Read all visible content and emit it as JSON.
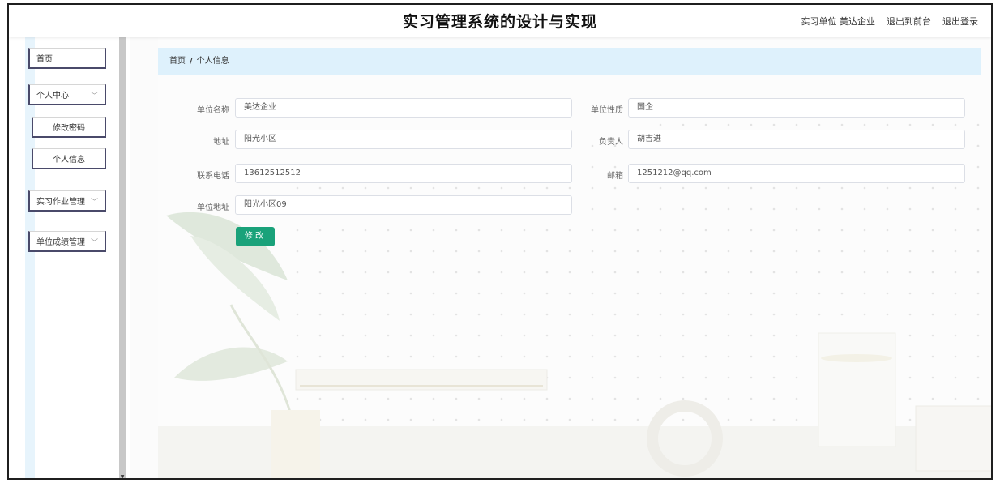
{
  "header": {
    "title": "实习管理系统的设计与实现",
    "user_role": "实习单位",
    "user_name": "美达企业",
    "front_link": "退出到前台",
    "logout_link": "退出登录"
  },
  "sidebar": {
    "items": [
      {
        "label": "首页"
      },
      {
        "label": "个人中心",
        "icon": "chevron-down-icon"
      },
      {
        "label": "修改密码"
      },
      {
        "label": "个人信息"
      },
      {
        "label": "实习作业管理",
        "icon": "chevron-down-icon"
      },
      {
        "label": "单位成绩管理",
        "icon": "chevron-down-icon"
      }
    ]
  },
  "breadcrumb": {
    "home": "首页",
    "separator": "/",
    "current": "个人信息"
  },
  "form": {
    "unit_name_label": "单位名称",
    "unit_name_value": "美达企业",
    "unit_type_label": "单位性质",
    "unit_type_value": "国企",
    "address_label": "地址",
    "address_value": "阳光小区",
    "manager_label": "负责人",
    "manager_value": "胡吉进",
    "phone_label": "联系电话",
    "phone_value": "13612512512",
    "email_label": "邮箱",
    "email_value": "1251212@qq.com",
    "unit_address_label": "单位地址",
    "unit_address_value": "阳光小区09",
    "submit_label": "修改"
  },
  "colors": {
    "accent": "#1aa27a",
    "breadcrumb_bg": "#def1fc",
    "sidebar_border": "#4a4a6a"
  }
}
